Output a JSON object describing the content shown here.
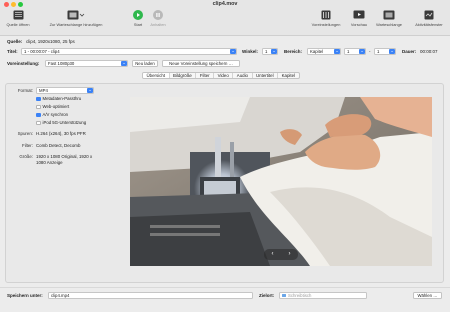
{
  "window": {
    "title": "clip4.mov"
  },
  "toolbar": {
    "open_source": "Quelle öffnen",
    "add_to_queue": "Zur Warteschlange hinzufügen",
    "start": "Start",
    "pause": "Anhalten",
    "presets": "Voreinstellungen",
    "preview": "Vorschau",
    "queue": "Warteschlange",
    "activity": "Aktivitätsfenster"
  },
  "source": {
    "label": "Quelle:",
    "value": "clip4, 1920x1080, 25 fps"
  },
  "title_row": {
    "title_label": "Titel:",
    "title_value": "1 - 00:00:07 - clip4",
    "angle_label": "Winkel:",
    "angle_value": "1",
    "range_label": "Bereich:",
    "range_type": "Kapitel",
    "range_from": "1",
    "range_sep": "-",
    "range_to": "1",
    "duration_label": "Dauer:",
    "duration_value": "00:00:07"
  },
  "preset_row": {
    "label": "Voreinstellung:",
    "value": "Fast 1080p30",
    "reload": "Neu laden",
    "save_new": "Neue Voreinstellung speichern …"
  },
  "tabs": [
    "Übersicht",
    "Bildgröße",
    "Filter",
    "Video",
    "Audio",
    "Untertitel",
    "Kapitel"
  ],
  "summary": {
    "format_label": "Format:",
    "format_value": "MP4",
    "checkboxes": [
      {
        "label": "Metadaten-Passthru",
        "checked": true
      },
      {
        "label": "Web-optimiert",
        "checked": false
      },
      {
        "label": "A/V synchron",
        "checked": true
      },
      {
        "label": "iPod 5G-Unterstützung",
        "checked": false
      }
    ],
    "tracks_label": "Spuren:",
    "tracks_value": "H.264 (x264), 30 fps PFR",
    "filter_label": "Filter:",
    "filter_value": "Comb Detect, Decomb",
    "size_label": "Größe:",
    "size_value_line1": "1920 x 1080 Original, 1920 x",
    "size_value_line2": "1080 Anzeige"
  },
  "preview_nav": {
    "prev": "‹",
    "next": "›"
  },
  "footer": {
    "save_label": "Speichern unter:",
    "save_value": "clip4.mp4",
    "dest_label": "Zielort:",
    "dest_value": "Schreibtisch",
    "choose": "Wählen …"
  },
  "icons": [
    "open-source-icon",
    "add-queue-icon",
    "start-icon",
    "pause-icon",
    "presets-icon",
    "preview-icon",
    "queue-icon",
    "activity-icon",
    "folder-icon"
  ],
  "colors": {
    "accent": "#3b82f6",
    "start_green": "#2fb84d"
  }
}
